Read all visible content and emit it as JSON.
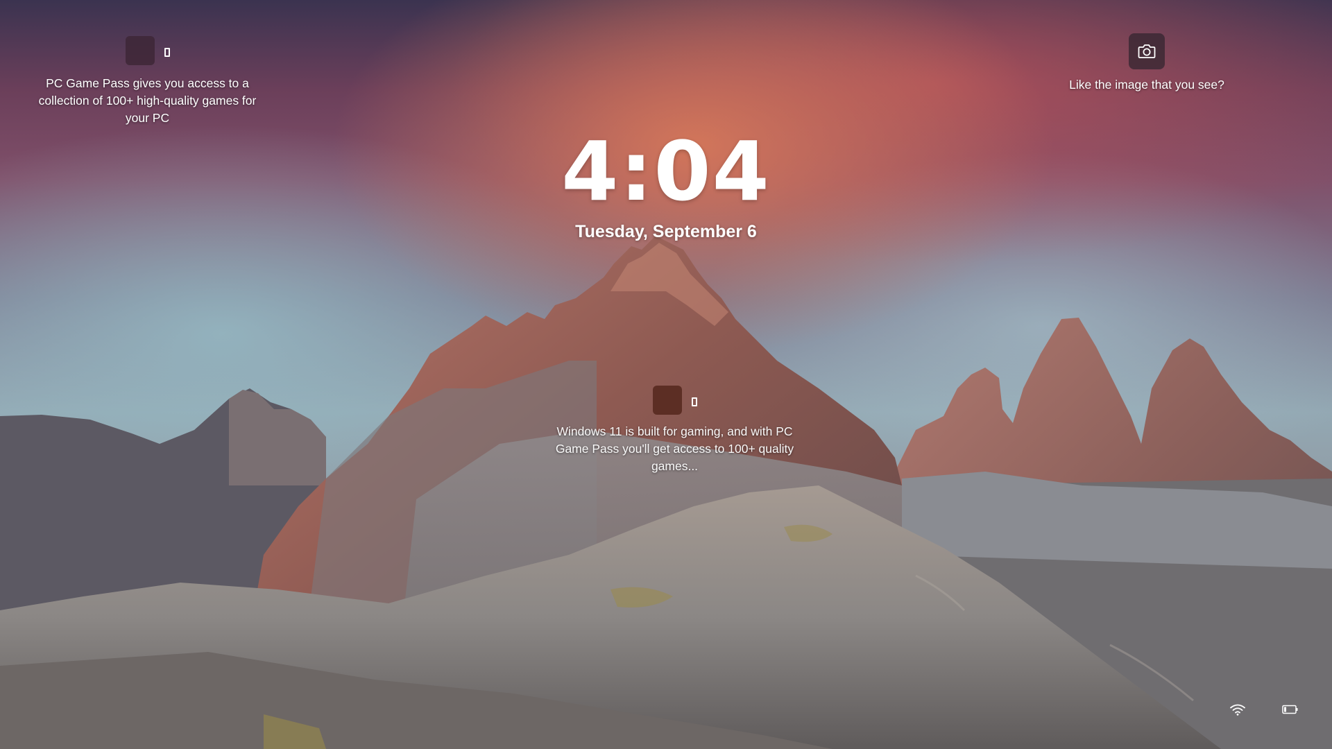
{
  "lockscreen": {
    "clock": {
      "time": "4:04"
    },
    "date": "Tuesday, September 6",
    "tips": {
      "left": {
        "text": "PC Game Pass gives you access to a collection of 100+ high-quality games for your PC",
        "icon": "app-tile-icon",
        "link_icon": "link-icon"
      },
      "center": {
        "text": "Windows 11 is built for gaming, and with PC Game Pass you'll get access to 100+ quality games...",
        "icon": "app-tile-icon",
        "link_icon": "link-icon"
      }
    },
    "spotlight": {
      "text": "Like the image that you see?",
      "icon": "camera-icon"
    },
    "status": {
      "network_icon": "wifi-icon",
      "battery_icon": "battery-icon",
      "battery_level": 0.2
    },
    "colors": {
      "text": "#ffffff",
      "tile_left": "#3c2634",
      "tile_center": "#5c2e24"
    }
  }
}
